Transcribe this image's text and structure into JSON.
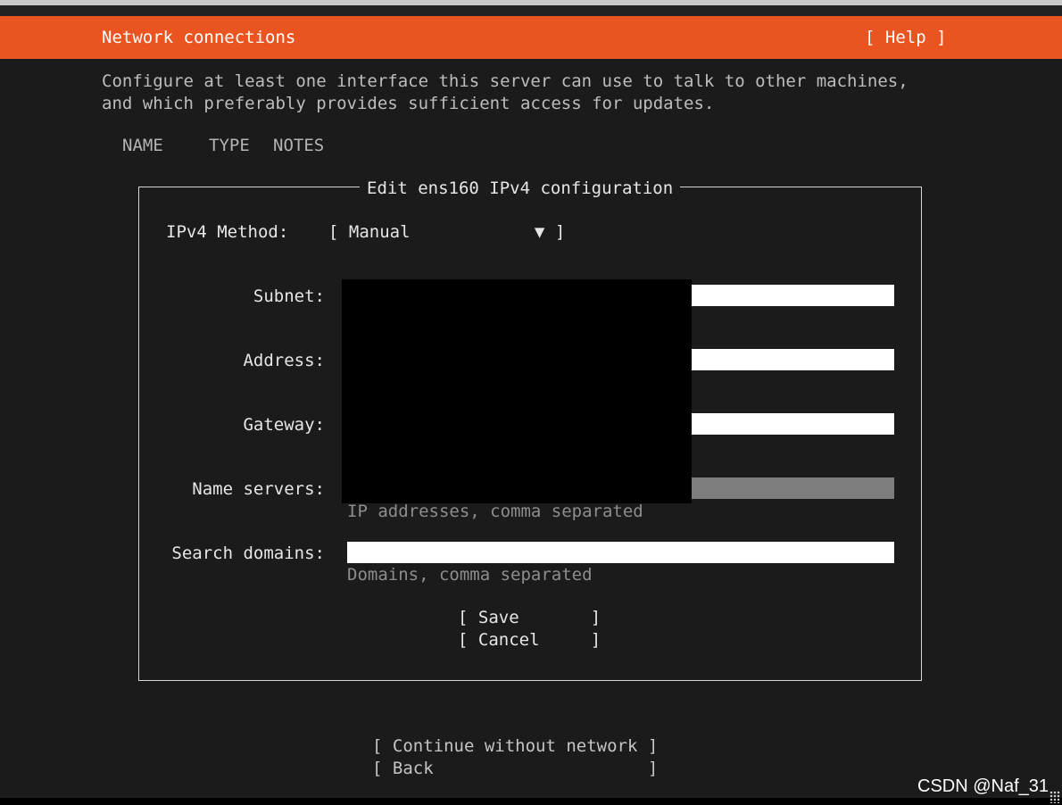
{
  "header": {
    "title": "Network connections",
    "help_label": "[ Help ]",
    "colors": {
      "accent": "#e95420",
      "background": "#1b1b1b"
    }
  },
  "intro": {
    "line1": "Configure at least one interface this server can use to talk to other machines,",
    "line2": "and which preferably provides sufficient access for updates."
  },
  "table": {
    "columns": [
      "NAME",
      "TYPE",
      "NOTES"
    ]
  },
  "dialog": {
    "title": "Edit ens160 IPv4 configuration",
    "method": {
      "label": "IPv4 Method:",
      "open_bracket": "[",
      "value": "Manual",
      "arrow_icon": "▼",
      "close_bracket": "]"
    },
    "fields": {
      "subnet": {
        "label": "Subnet:",
        "value": ""
      },
      "address": {
        "label": "Address:",
        "value": ""
      },
      "gateway": {
        "label": "Gateway:",
        "value": ""
      },
      "name_servers": {
        "label": "Name servers:",
        "value": "",
        "hint": "IP addresses, comma separated"
      },
      "search_domains": {
        "label": "Search domains:",
        "value": "",
        "hint": "Domains, comma separated"
      }
    },
    "buttons": {
      "save": "[ Save       ]",
      "cancel": "[ Cancel     ]"
    }
  },
  "footer": {
    "continue": "[ Continue without network ]",
    "back": "[ Back                     ]"
  },
  "watermark": "CSDN @Naf_31"
}
